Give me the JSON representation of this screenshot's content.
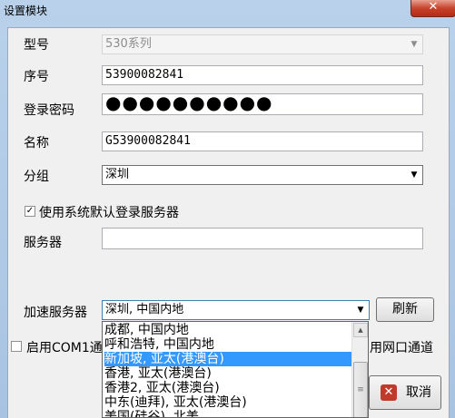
{
  "window": {
    "title": "设置模块",
    "close_label": "✕"
  },
  "form": {
    "model_label": "型号",
    "model_value": "530系列",
    "serial_label": "序号",
    "serial_value": "53900082841",
    "password_label": "登录密码",
    "password_mask": "●●●●●●●●●●",
    "name_label": "名称",
    "name_value": "G53900082841",
    "group_label": "分组",
    "group_value": "深圳",
    "default_server_checkbox_label": "使用系统默认登录服务器",
    "default_server_checked": true,
    "server_label": "服务器",
    "server_value": "",
    "accel_label": "加速服务器",
    "accel_value": "深圳, 中国内地",
    "refresh_label": "刷新",
    "com1_label": "启用COM1通道",
    "network_label": "用网口通道"
  },
  "dropdown": {
    "options": [
      "成都, 中国内地",
      "呼和浩特, 中国内地",
      "新加坡, 亚太(港澳台)",
      "香港, 亚太(港澳台)",
      "香港2, 亚太(港澳台)",
      "中东(迪拜), 亚太(港澳台)",
      "美国(硅谷), 北美"
    ],
    "selected_index": 2
  },
  "buttons": {
    "cancel_label": "取消"
  },
  "colors": {
    "selection": "#3399ff",
    "cancel_icon": "#c0392b"
  },
  "icons": {
    "cancel": "cancel-x-icon",
    "dropdown": "chevron-down-icon"
  }
}
